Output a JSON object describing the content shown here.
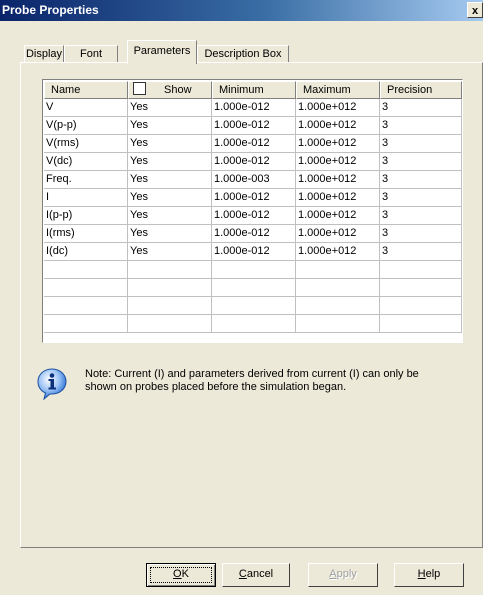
{
  "window": {
    "title": "Probe Properties",
    "close_label": "x"
  },
  "tabs": [
    {
      "label": "Display",
      "active": false
    },
    {
      "label": "Font",
      "active": false
    },
    {
      "label": "Parameters",
      "active": true
    },
    {
      "label": "Description Box",
      "active": false
    }
  ],
  "table": {
    "columns": [
      "Name",
      "Show",
      "Minimum",
      "Maximum",
      "Precision"
    ],
    "show_header_checked": false,
    "rows": [
      {
        "name": "V",
        "show": "Yes",
        "min": "1.000e-012",
        "max": "1.000e+012",
        "precision": "3"
      },
      {
        "name": "V(p-p)",
        "show": "Yes",
        "min": "1.000e-012",
        "max": "1.000e+012",
        "precision": "3"
      },
      {
        "name": "V(rms)",
        "show": "Yes",
        "min": "1.000e-012",
        "max": "1.000e+012",
        "precision": "3"
      },
      {
        "name": "V(dc)",
        "show": "Yes",
        "min": "1.000e-012",
        "max": "1.000e+012",
        "precision": "3"
      },
      {
        "name": "Freq.",
        "show": "Yes",
        "min": "1.000e-003",
        "max": "1.000e+012",
        "precision": "3"
      },
      {
        "name": "I",
        "show": "Yes",
        "min": "1.000e-012",
        "max": "1.000e+012",
        "precision": "3"
      },
      {
        "name": "I(p-p)",
        "show": "Yes",
        "min": "1.000e-012",
        "max": "1.000e+012",
        "precision": "3"
      },
      {
        "name": "I(rms)",
        "show": "Yes",
        "min": "1.000e-012",
        "max": "1.000e+012",
        "precision": "3"
      },
      {
        "name": "I(dc)",
        "show": "Yes",
        "min": "1.000e-012",
        "max": "1.000e+012",
        "precision": "3"
      }
    ],
    "empty_rows": 4
  },
  "note": {
    "icon": "info-icon",
    "text": "Note: Current (I) and parameters derived from current (I) can only be shown on probes placed before the simulation began."
  },
  "buttons": {
    "ok": {
      "label": "OK",
      "mnemonic": "O"
    },
    "cancel": {
      "label": "Cancel",
      "mnemonic": "C"
    },
    "apply": {
      "label": "Apply",
      "mnemonic": "A",
      "disabled": true
    },
    "help": {
      "label": "Help",
      "mnemonic": "H"
    }
  },
  "colors": {
    "title_bar_start": "#0a246a",
    "title_bar_end": "#a6caf0",
    "dialog_face": "#ece9d8",
    "info_icon_blue": "#2a6fd6"
  }
}
